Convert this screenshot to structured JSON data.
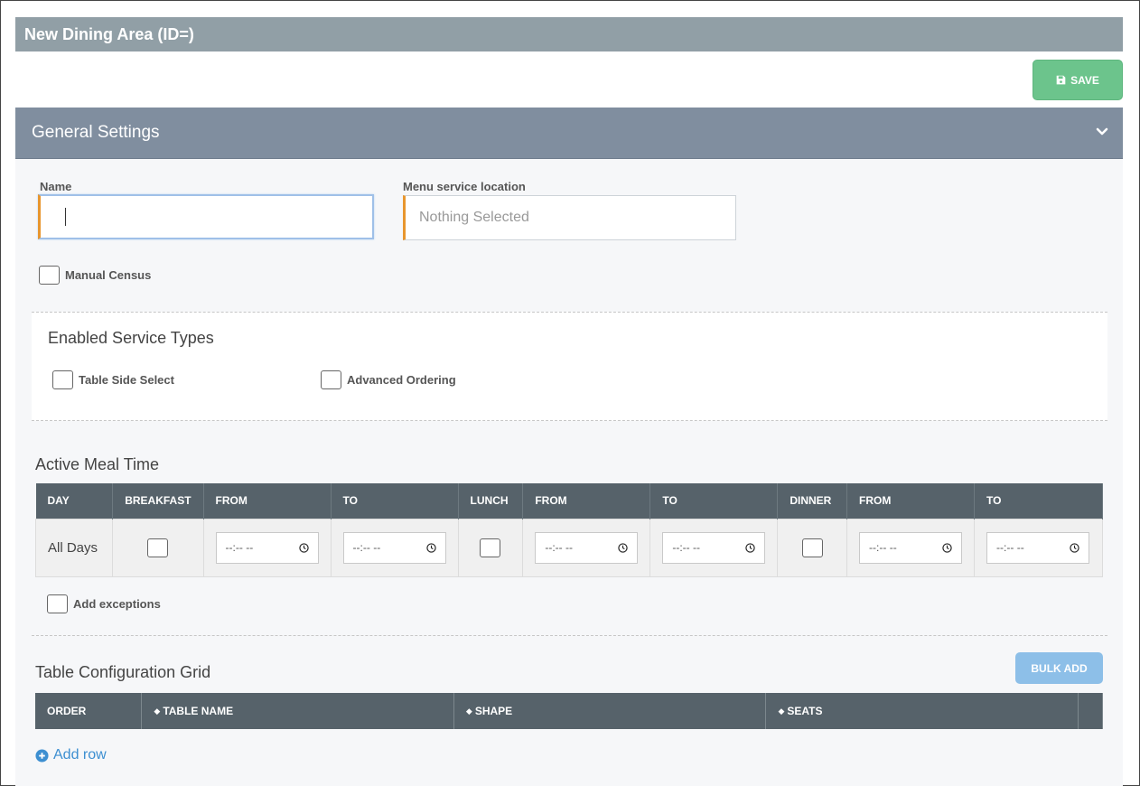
{
  "header": {
    "title": "New Dining Area (ID=)"
  },
  "toolbar": {
    "save_label": "SAVE"
  },
  "panel": {
    "title": "General Settings"
  },
  "form": {
    "name_label": "Name",
    "name_value": "",
    "menu_location_label": "Menu service location",
    "menu_location_value": "Nothing Selected",
    "manual_census_label": "Manual Census"
  },
  "service_types": {
    "title": "Enabled Service Types",
    "items": [
      {
        "label": "Table Side Select",
        "checked": false
      },
      {
        "label": "Advanced Ordering",
        "checked": false
      }
    ]
  },
  "meal_time": {
    "title": "Active Meal Time",
    "headers": [
      "DAY",
      "BREAKFAST",
      "FROM",
      "TO",
      "LUNCH",
      "FROM",
      "TO",
      "DINNER",
      "FROM",
      "TO"
    ],
    "rows": [
      {
        "day": "All Days",
        "breakfast": false,
        "breakfast_from": "--:-- --",
        "breakfast_to": "--:-- --",
        "lunch": false,
        "lunch_from": "--:-- --",
        "lunch_to": "--:-- --",
        "dinner": false,
        "dinner_from": "--:-- --",
        "dinner_to": "--:-- --"
      }
    ],
    "add_exceptions_label": "Add exceptions"
  },
  "table_grid": {
    "title": "Table Configuration Grid",
    "bulk_add_label": "BULK ADD",
    "headers": [
      "ORDER",
      "TABLE NAME",
      "SHAPE",
      "SEATS"
    ],
    "add_row_label": "Add row"
  },
  "colors": {
    "accent_save": "#6cc48c",
    "accent_bulk": "#8dbfe8",
    "required_marker": "#e8962e",
    "table_header": "#56626a",
    "link": "#3d8fd1"
  }
}
